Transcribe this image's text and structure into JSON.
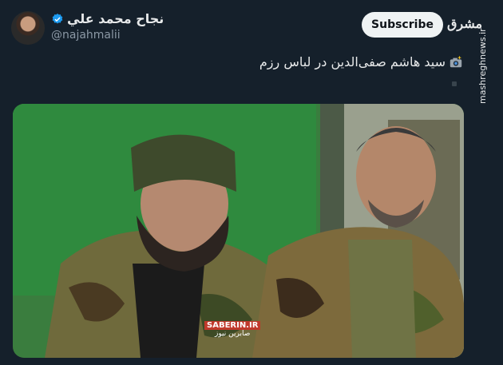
{
  "user": {
    "display_name": "نجاح محمد علي",
    "handle": "@najahmalii"
  },
  "actions": {
    "subscribe_label": "Subscribe"
  },
  "logo_text": "مشرق",
  "side_watermark": "mashreghnews.ir",
  "tweet": {
    "text": "سید هاشم صفی‌الدین در لباس رزم",
    "emoji": "camera-flash-icon"
  },
  "photo": {
    "watermark_top": "SABERIN.IR",
    "watermark_bottom": "صابرین نیوز"
  },
  "colors": {
    "background": "#15202b",
    "verified": "#1d9bf0",
    "subscribe_bg": "#eff3f4"
  }
}
